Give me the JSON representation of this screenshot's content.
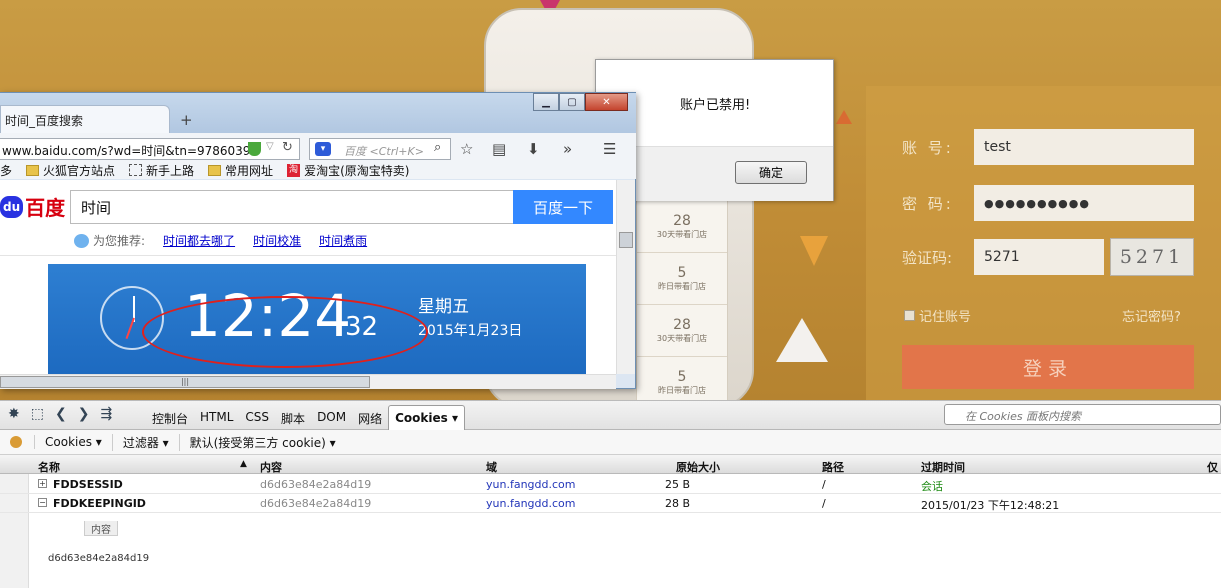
{
  "alert": {
    "message": "账户已禁用!",
    "ok_label": "确定"
  },
  "login": {
    "account_label": "账 号:",
    "account_value": "test",
    "password_label": "密 码:",
    "password_mask": "●●●●●●●●●●",
    "captcha_label": "验证码:",
    "captcha_value": "5271",
    "captcha_image_text": "5271",
    "remember_label": "记住账号",
    "forgot_label": "忘记密码?",
    "login_button": "登录"
  },
  "phone": {
    "cells": [
      {
        "num": "28",
        "sub": "30天带看门店"
      },
      {
        "num": "5",
        "sub": "昨日带看门店"
      },
      {
        "num": "28",
        "sub": "30天带看门店"
      },
      {
        "num": "5",
        "sub": "昨日带看门店"
      }
    ]
  },
  "browser": {
    "tab_title": "时间_百度搜索",
    "url": "www.baidu.com/s?wd=时间&tn=9786039",
    "search_placeholder": "百度 <Ctrl+K>",
    "bookmarks": [
      "多",
      "火狐官方站点",
      "新手上路",
      "常用网址",
      "爱淘宝(原淘宝特卖)"
    ],
    "baidu": {
      "logo": "百度",
      "logo_du": "du",
      "query": "时间",
      "button": "百度一下",
      "rec_label": "为您推荐:",
      "recs": [
        "时间都去哪了",
        "时间校准",
        "时间煮雨"
      ],
      "time": "12:24",
      "seconds": "32",
      "weekday": "星期五",
      "date": "2015年1月23日"
    }
  },
  "firebug": {
    "tabs": [
      "控制台",
      "HTML",
      "CSS",
      "脚本",
      "DOM",
      "网络",
      "Cookies ▾"
    ],
    "search_placeholder": "在 Cookies 面板内搜索",
    "sub_toolbar": [
      "Cookies ▾",
      "过滤器 ▾",
      "默认(接受第三方 cookie) ▾"
    ],
    "columns": [
      "名称",
      "内容",
      "域",
      "原始大小",
      "路径",
      "过期时间",
      "仅"
    ],
    "rows": [
      {
        "name": "FDDSESSID",
        "value": "d6d63e84e2a84d19",
        "domain": "yun.fangdd.com",
        "size": "25 B",
        "path": "/",
        "expires": "会话"
      },
      {
        "name": "FDDKEEPINGID",
        "value": "d6d63e84e2a84d19",
        "domain": "yun.fangdd.com",
        "size": "28 B",
        "path": "/",
        "expires": "2015/01/23 下午12:48:21"
      }
    ],
    "detail_tab": "内容",
    "detail_value": "d6d63e84e2a84d19"
  },
  "colors": {
    "alert_red": "#e0201c",
    "baidu_blue": "#3388ff",
    "login_btn": "#e2754a",
    "expires_green": "#1c8a12"
  }
}
